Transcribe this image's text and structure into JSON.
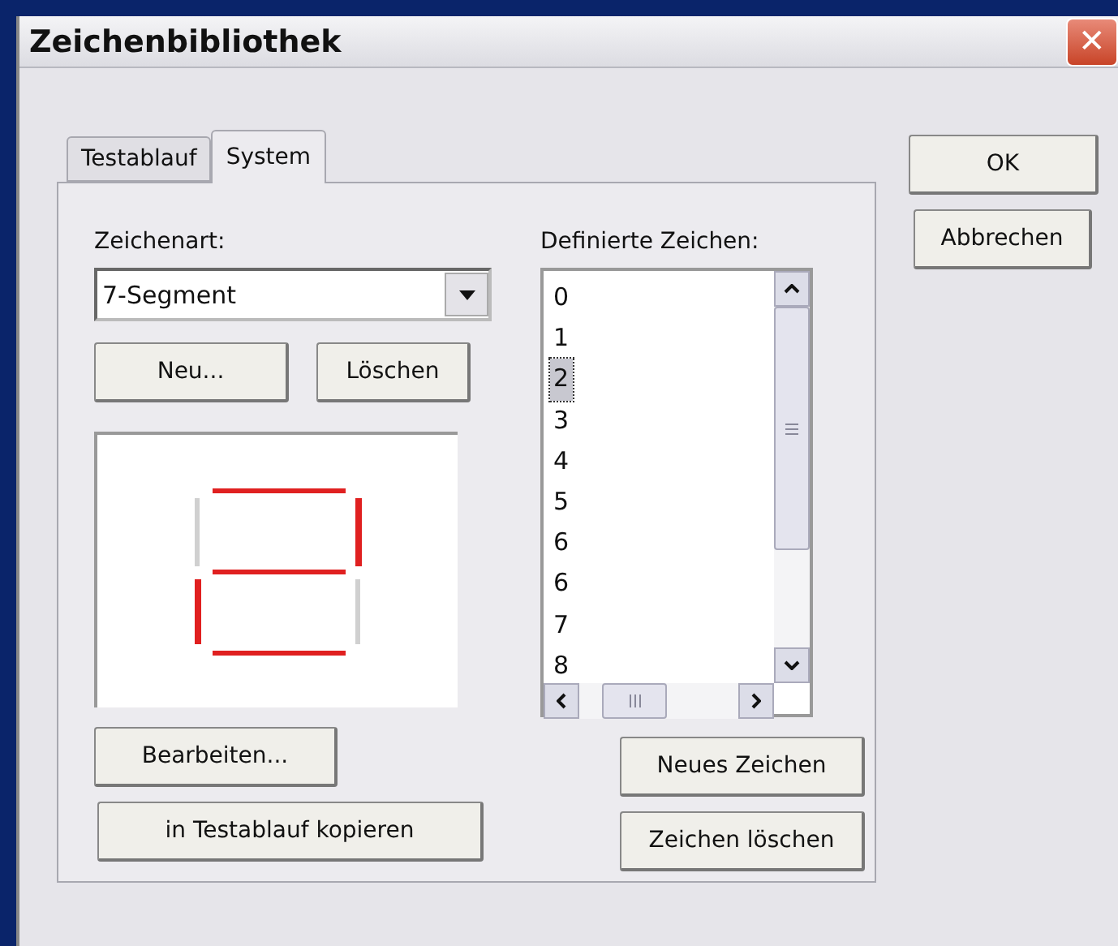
{
  "window": {
    "title": "Zeichenbibliothek",
    "close": "✕"
  },
  "tabs": [
    {
      "label": "Testablauf",
      "selected": false
    },
    {
      "label": "System",
      "selected": true
    }
  ],
  "type_label": "Zeichenart:",
  "type_select": {
    "value": "7-Segment"
  },
  "type_buttons": [
    "Neu...",
    "Löschen"
  ],
  "segments": [
    {
      "on": true
    },
    {
      "on": true
    },
    {
      "on": false
    },
    {
      "on": true
    },
    {
      "on": true
    },
    {
      "on": false
    },
    {
      "on": true
    }
  ],
  "defined_label": "Definierte Zeichen:",
  "characters": [
    {
      "label": "0",
      "selected": false
    },
    {
      "label": "1",
      "selected": false
    },
    {
      "label": "2",
      "selected": true
    },
    {
      "label": "3",
      "selected": false
    },
    {
      "label": "4",
      "selected": false
    },
    {
      "label": "5",
      "selected": false
    },
    {
      "label": "6",
      "selected": false
    },
    {
      "label": "6",
      "selected": false
    },
    {
      "label": "7",
      "selected": false
    },
    {
      "label": "8",
      "selected": false
    }
  ],
  "left_buttons": [
    "Bearbeiten...",
    "in Testablauf kopieren"
  ],
  "right_buttons": [
    "Neues Zeichen",
    "Zeichen löschen"
  ],
  "dialog_buttons": [
    "OK",
    "Abbrechen"
  ]
}
